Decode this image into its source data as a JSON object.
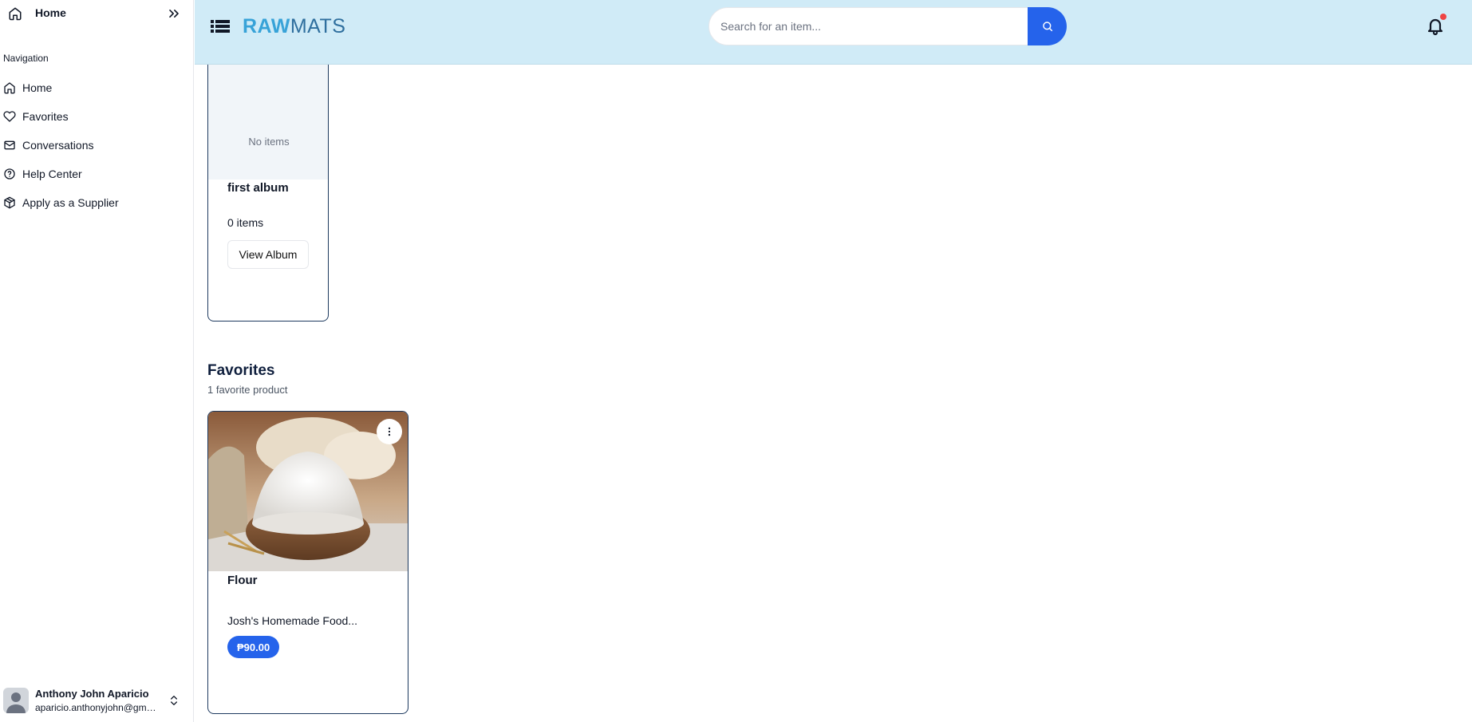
{
  "sidebar": {
    "title": "Home",
    "section_label": "Navigation",
    "items": [
      {
        "label": "Home",
        "icon": "home-icon"
      },
      {
        "label": "Favorites",
        "icon": "heart-icon"
      },
      {
        "label": "Conversations",
        "icon": "mail-icon"
      },
      {
        "label": "Help Center",
        "icon": "help-circle-icon"
      },
      {
        "label": "Apply as a Supplier",
        "icon": "package-icon"
      }
    ],
    "user": {
      "name": "Anthony John Aparicio",
      "email": "aparicio.anthonyjohn@gmail.com"
    }
  },
  "header": {
    "logo_bold": "RAW",
    "logo_light": "MATS",
    "search_placeholder": "Search for an item...",
    "notification_badge_color": "#ef4444"
  },
  "album": {
    "empty_label": "No items",
    "title": "first album",
    "count": "0 items",
    "button": "View Album"
  },
  "favorites": {
    "title": "Favorites",
    "subtitle": "1 favorite product",
    "products": [
      {
        "name": "Flour",
        "seller": "Josh's Homemade Food...",
        "price": "₱90.00"
      }
    ]
  },
  "colors": {
    "accent": "#2563eb",
    "header_bg": "#d0ebf7",
    "logo_primary": "#38a3d8",
    "logo_secondary": "#2f6f9e"
  }
}
